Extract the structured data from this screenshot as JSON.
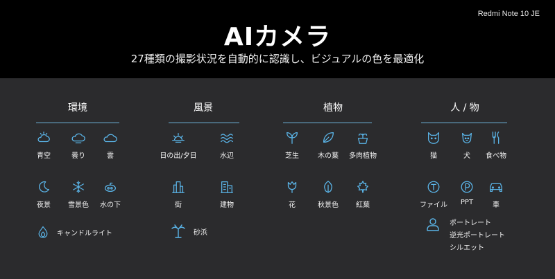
{
  "header": {
    "model": "Redmi Note 10 JE",
    "title": "AIカメラ",
    "subtitle": "27種類の撮影状況を自動的に認識し、ビジュアルの色を最適化"
  },
  "categories": [
    {
      "label": "環境"
    },
    {
      "label": "風景"
    },
    {
      "label": "植物"
    },
    {
      "label": "人 / 物"
    }
  ],
  "items": {
    "sunny": "青空",
    "cloudy": "曇り",
    "cloud": "雲",
    "night": "夜景",
    "snow": "雪景色",
    "underwater": "水の下",
    "candle": "キャンドルライト",
    "sunrise": "日の出/夕日",
    "water": "水辺",
    "street": "街",
    "building": "建物",
    "beach": "砂浜",
    "lawn": "芝生",
    "leaf": "木の葉",
    "succulent": "多肉植物",
    "flower": "花",
    "autumn": "秋景色",
    "maple": "紅葉",
    "cat": "猫",
    "dog": "犬",
    "food": "食べ物",
    "file": "ファイル",
    "ppt": "PPT",
    "car": "車",
    "portrait": "ポートレート",
    "backlit": "逆光ポートレート",
    "silhouette": "シルエット"
  },
  "icon_color": "#5bb6ea"
}
